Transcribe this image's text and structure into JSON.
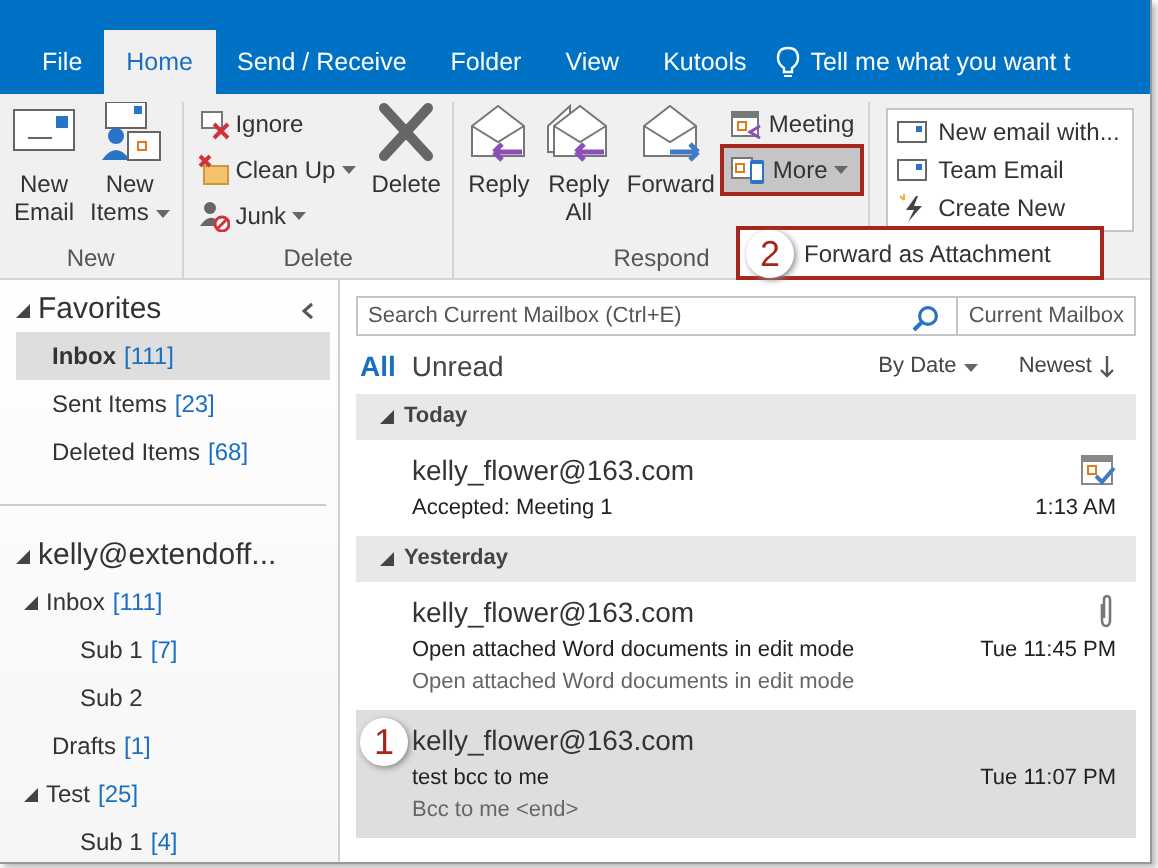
{
  "tabs": [
    {
      "label": "File",
      "selected": false
    },
    {
      "label": "Home",
      "selected": true
    },
    {
      "label": "Send / Receive",
      "selected": false
    },
    {
      "label": "Folder",
      "selected": false
    },
    {
      "label": "View",
      "selected": false
    },
    {
      "label": "Kutools",
      "selected": false
    }
  ],
  "tell_me": "Tell me what you want t",
  "ribbon_groups": [
    {
      "label": "New",
      "items": [
        {
          "kind": "large",
          "label": "New Email"
        },
        {
          "kind": "large",
          "label": "New Items",
          "dropdown": true
        }
      ]
    },
    {
      "label": "Delete",
      "items": [
        {
          "kind": "small",
          "label": "Ignore"
        },
        {
          "kind": "small",
          "label": "Clean Up",
          "dropdown": true
        },
        {
          "kind": "small",
          "label": "Junk",
          "dropdown": true
        },
        {
          "kind": "large",
          "label": "Delete"
        }
      ]
    },
    {
      "label": "Respond",
      "items": [
        {
          "kind": "large",
          "label": "Reply"
        },
        {
          "kind": "large",
          "label": "Reply All"
        },
        {
          "kind": "large",
          "label": "Forward"
        },
        {
          "kind": "small",
          "label": "Meeting"
        },
        {
          "kind": "small",
          "label": "More",
          "dropdown": true,
          "highlighted": true
        }
      ]
    }
  ],
  "quick_steps": [
    "New email with...",
    "Team Email",
    "Create New"
  ],
  "more_menu": {
    "items": [
      "Forward as Attachment"
    ]
  },
  "callouts": [
    "2",
    "1"
  ],
  "folders": [
    {
      "name": "Favorites",
      "expanded": true,
      "children": [
        {
          "name": "Inbox",
          "count": "[111]",
          "selected": true
        },
        {
          "name": "Sent Items",
          "count": "[23]",
          "selected": false
        },
        {
          "name": "Deleted Items",
          "count": "[68]",
          "selected": false
        }
      ]
    },
    {
      "name": "kelly@extendoff...",
      "expanded": true,
      "children": [
        {
          "name": "Inbox",
          "count": "[111]",
          "selected": false,
          "expanded": true,
          "children": [
            {
              "name": "Sub 1",
              "count": "[7]",
              "selected": false
            },
            {
              "name": "Sub 2",
              "selected": false
            }
          ]
        },
        {
          "name": "Drafts",
          "count": "[1]",
          "selected": false
        },
        {
          "name": "Test",
          "count": "[25]",
          "selected": false,
          "expanded": true,
          "children": [
            {
              "name": "Sub 1",
              "count": "[4]",
              "selected": false
            }
          ]
        }
      ]
    }
  ],
  "search": {
    "placeholder": "Search Current Mailbox (Ctrl+E)",
    "scope": "Current Mailbox"
  },
  "filters": [
    {
      "label": "All",
      "selected": true
    },
    {
      "label": "Unread",
      "selected": false
    }
  ],
  "sort": {
    "by": "By Date",
    "order": "Newest"
  },
  "message_groups": [
    {
      "label": "Today",
      "expanded": true,
      "messages": [
        {
          "kind": "meeting",
          "sender": "kelly_flower@163.com",
          "subject": "Accepted: Meeting 1",
          "time": "1:13 AM",
          "selected": false
        }
      ]
    },
    {
      "label": "Yesterday",
      "expanded": true,
      "messages": [
        {
          "kind": "attachment",
          "sender": "kelly_flower@163.com",
          "subject": "Open attached Word documents in edit mode",
          "preview": "Open attached Word documents in edit mode",
          "time": "Tue 11:45 PM",
          "selected": false
        },
        {
          "kind": "plain",
          "sender": "kelly_flower@163.com",
          "subject": "test bcc to me",
          "preview": "Bcc to me <end>",
          "time": "Tue 11:07 PM",
          "selected": true
        }
      ]
    }
  ]
}
